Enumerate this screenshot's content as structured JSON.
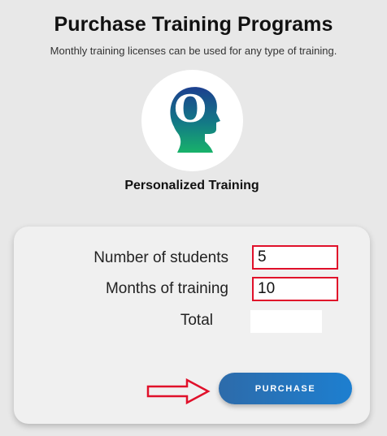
{
  "header": {
    "title": "Purchase Training Programs",
    "subtitle": "Monthly training licenses can be used for any type of training."
  },
  "program": {
    "logo_icon": "head-with-o-logo-icon",
    "logo_letter": "O",
    "name": "Personalized Training"
  },
  "form": {
    "students_label": "Number of students",
    "students_value": "5",
    "months_label": "Months of training",
    "months_value": "10",
    "total_label": "Total",
    "total_value": "",
    "highlight_color": "#e0102a"
  },
  "actions": {
    "purchase_label": "PURCHASE",
    "arrow_icon": "right-arrow-icon",
    "button_color": "#1d7fd0"
  }
}
